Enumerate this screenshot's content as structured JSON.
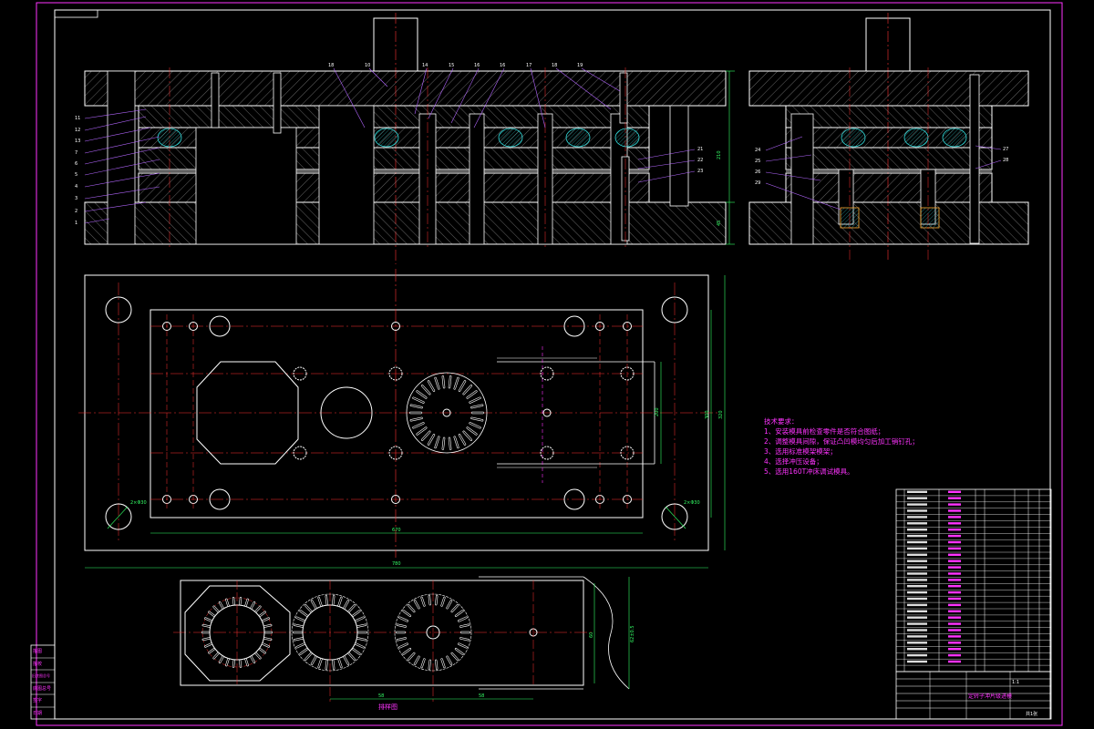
{
  "colors": {
    "background": "#000000",
    "outline": "#ffffff",
    "border": "#ff33ff",
    "centerline": "#ff3333",
    "hatch": "#bbbbbb",
    "dimension": "#33ff66",
    "spring": "#33dddd",
    "callout": "#b366ff"
  },
  "drawing": {
    "part_labels": [
      "18",
      "10",
      "14",
      "15",
      "16",
      "16",
      "17",
      "18",
      "19"
    ],
    "side_left_labels": [
      "11",
      "12",
      "13",
      "7",
      "6",
      "5",
      "4",
      "3",
      "2",
      "1"
    ],
    "side_right_labels": [
      "21",
      "22",
      "23"
    ],
    "right_view_left_labels": [
      "24",
      "25",
      "26",
      "29"
    ],
    "right_view_right_labels": [
      "27",
      "28"
    ],
    "dim_height": "210",
    "dim_small": "45",
    "dim_plan_width_inner": "670",
    "dim_plan_width_outer": "780",
    "dim_plan_height_a": "300",
    "dim_plan_height_b": "320",
    "dim_plan_inner": "200",
    "hole_callout_left": "2×Φ30",
    "hole_callout_right": "2×Φ30",
    "strip_width": "60",
    "strip_width_b": "62±0.5",
    "pitch_1": "58",
    "pitch_2": "58",
    "strip_title": "排样图"
  },
  "notes": {
    "title": "技术要求：",
    "items": [
      "1、安装模具前检查零件是否符合图纸；",
      "2、调整模具间隙，保证凸凹模均匀后加工销钉孔；",
      "3、选用标准模架模架；",
      "4、选择冲压设备；",
      "5、选用160T冲床调试模具。"
    ]
  },
  "title_block": {
    "part_name": "定转子冲片级进模",
    "scale": "1:1",
    "sheet": "共1张"
  },
  "stamp": {
    "lines": [
      "描图",
      "描校",
      "旧底图总号",
      "底图总号",
      "签字",
      "日期"
    ]
  },
  "bom": {
    "row_count": 29
  }
}
